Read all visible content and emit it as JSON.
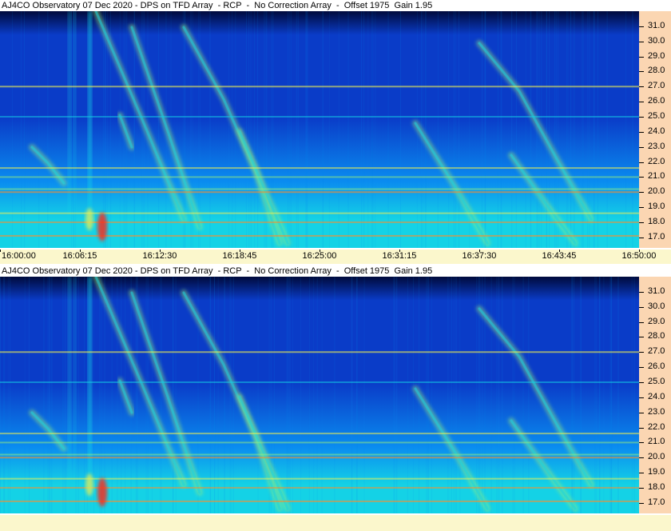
{
  "window": {
    "title": "AJ4CO Observatory 07 Dec 2020 - DPS on TFD Array  - RCP  -  No Correction Array  -  Offset 1975  Gain 1.95"
  },
  "chart_data": [
    {
      "type": "heatmap",
      "title": "AJ4CO Observatory 07 Dec 2020 - DPS on TFD Array  - RCP  -  No Correction Array  -  Offset 1975  Gain 1.95",
      "xlabel": "",
      "ylabel": "",
      "x_ticks": [
        "16:00:00",
        "16:06:15",
        "16:12:30",
        "16:18:45",
        "16:25:00",
        "16:31:15",
        "16:37:30",
        "16:43:45",
        "16:50:00"
      ],
      "y_ticks": [
        "17.0",
        "18.0",
        "19.0",
        "20.0",
        "21.0",
        "22.0",
        "23.0",
        "24.0",
        "25.0",
        "26.0",
        "27.0",
        "28.0",
        "29.0",
        "30.0",
        "31.0"
      ],
      "ylim": [
        16.3,
        32.0
      ],
      "colormap": [
        "#000a3c",
        "#0a3cc8",
        "#0a8cf0",
        "#14d2e6",
        "#9cf078",
        "#f0f050",
        "#ff8c28",
        "#ff2814"
      ],
      "grid": false
    },
    {
      "type": "heatmap",
      "title": "AJ4CO Observatory 07 Dec 2020 - DPS on TFD Array  - RCP  -  No Correction Array  -  Offset 1975  Gain 1.95",
      "xlabel": "",
      "ylabel": "",
      "x_ticks": [],
      "y_ticks": [
        "17.0",
        "18.0",
        "19.0",
        "20.0",
        "21.0",
        "22.0",
        "23.0",
        "24.0",
        "25.0",
        "26.0",
        "27.0",
        "28.0",
        "29.0",
        "30.0",
        "31.0"
      ],
      "ylim": [
        16.3,
        32.0
      ],
      "colormap": [
        "#000a3c",
        "#0a3cc8",
        "#0a8cf0",
        "#14d2e6",
        "#9cf078",
        "#f0f050",
        "#ff8c28",
        "#ff2814"
      ],
      "grid": false
    }
  ]
}
